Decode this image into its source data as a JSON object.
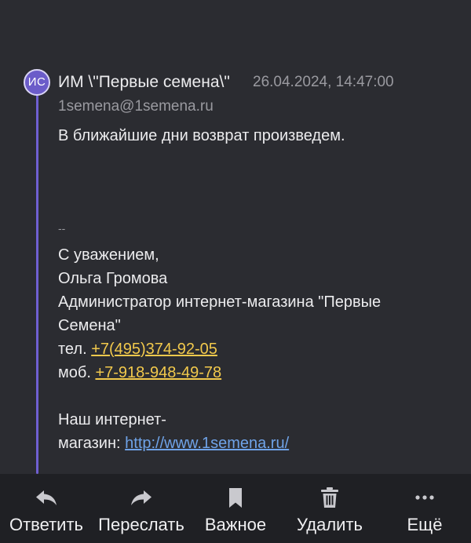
{
  "message": {
    "avatar_initials": "ИС",
    "sender_name": "ИМ \\\"Первые семена\\\"",
    "date": "26.04.2024, 14:47:00",
    "sender_email": "1semena@1semena.ru",
    "body_line_1": "В ближайшие дни возврат произведем.",
    "signature_dashes": "--",
    "greeting": "С уважением,",
    "name": "Ольга Громова",
    "position_line_1": "Администратор интернет-магазина \"Первые",
    "position_line_2": "Семена\"",
    "tel_label": "тел.",
    "tel_number": "+7(495)374-92-05",
    "mob_label": "моб.",
    "mob_number": "+7-918-948-49-78",
    "shop_line_1": "Наш интернет-",
    "shop_label": "магазин:",
    "shop_url": "http://www.1semena.ru/"
  },
  "toolbar": {
    "reply": {
      "label": "Ответить",
      "icon": "reply-icon"
    },
    "forward": {
      "label": "Переслать",
      "icon": "forward-icon"
    },
    "important": {
      "label": "Важное",
      "icon": "bookmark-icon"
    },
    "delete": {
      "label": "Удалить",
      "icon": "trash-icon"
    },
    "more": {
      "label": "Ещё",
      "icon": "more-dots-icon"
    }
  },
  "colors": {
    "background": "#2b2c31",
    "thread_line": "#6f5fd1",
    "phone_link": "#f2c94c",
    "url_link": "#6fa3e8",
    "toolbar_bg": "#1f2024"
  }
}
